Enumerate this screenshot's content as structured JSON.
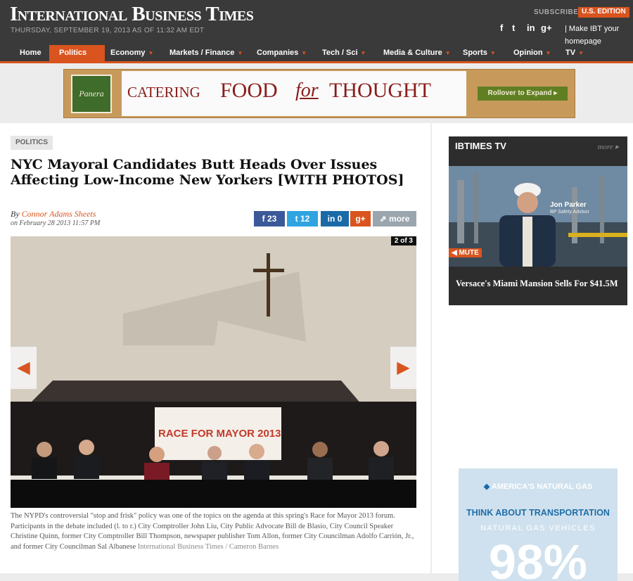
{
  "header": {
    "logo": "International Business Times",
    "dateline": "THURSDAY, SEPTEMBER 19, 2013 AS OF 11:32 AM EDT",
    "subscribe": "SUBSCRIBE",
    "edition": "U.S. EDITION",
    "social": [
      "f",
      "t",
      "in",
      "g+"
    ],
    "homepage_link": "| Make IBT your homepage"
  },
  "nav": {
    "items": [
      "Home",
      "Politics",
      "Economy",
      "Markets / Finance",
      "Companies",
      "Tech / Sci",
      "Media & Culture",
      "Sports",
      "Opinion",
      "TV"
    ],
    "active": "Politics"
  },
  "ad_banner": {
    "brand": "Panera",
    "brand_sub": "BREAD",
    "catering": "CATERING",
    "food": "FOOD",
    "for": "for",
    "thought": "THOUGHT",
    "cta": "Rollover to Expand ▸"
  },
  "article": {
    "section": "POLITICS",
    "headline": "NYC Mayoral Candidates Butt Heads Over Issues Affecting Low-Income New Yorkers [WITH PHOTOS]",
    "by": "By",
    "author": "Connor Adams Sheets",
    "posted": "on February 28 2013 11:57 PM",
    "share": {
      "facebook": "23",
      "twitter": "12",
      "linkedin": "0",
      "google": "g+",
      "more": "more"
    },
    "photo": {
      "counter": "2 of 3",
      "banner_text": "RACE FOR MAYOR 2013",
      "prev_icon": "◀",
      "next_icon": "▶"
    },
    "caption": "The NYPD's controversial \"stop and frisk\" policy was one of the topics on the agenda at this spring's Race for Mayor 2013 forum. Participants in the debate included (l. to r.) City Comptroller John Liu, City Public Advocate Bill de Blasio, City Council Speaker Christine Quinn, former City Comptroller Bill Thompson, newspaper publisher Tom Allon, former City Councilman Adolfo Carrión, Jr., and former City Councilman Sal Albanese",
    "credit": "International Business Times / Cameron Barnes"
  },
  "sidebar": {
    "tv_title": "IBTIMES TV",
    "tv_more": "more ▸",
    "video_name": "Jon Parker",
    "video_role": "BP Safety Advisor",
    "mute": "◀ MUTE",
    "video_caption": "Versace's Miami Mansion Sells For $41.5M",
    "ad": {
      "brand": "AMERICA'S NATURAL GAS",
      "headline": "THINK ABOUT TRANSPORTATION",
      "sub": "NATURAL GAS VEHICLES",
      "big": "98%"
    }
  }
}
